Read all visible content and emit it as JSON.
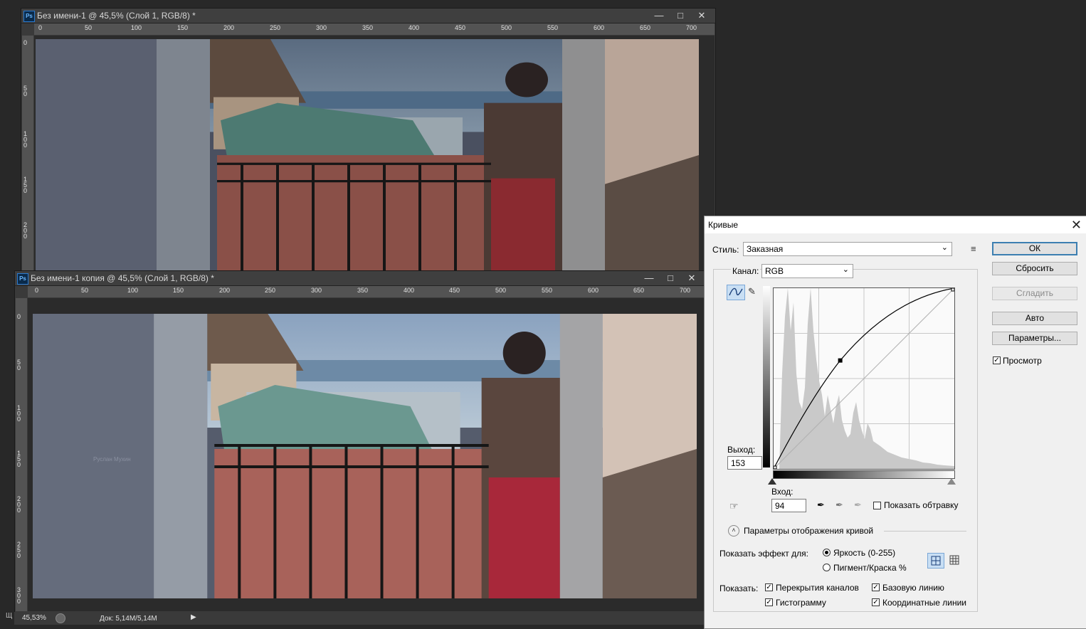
{
  "window1": {
    "title": "Без имени-1 @ 45,5% (Слой 1, RGB/8) *",
    "ruler_h": [
      "0",
      "50",
      "100",
      "150",
      "200",
      "250",
      "300",
      "350",
      "400",
      "450",
      "500",
      "550",
      "600",
      "650",
      "700"
    ],
    "ruler_v": [
      "0",
      "50",
      "100",
      "150",
      "200"
    ]
  },
  "window2": {
    "title": "Без имени-1 копия @ 45,5% (Слой 1, RGB/8) *",
    "ruler_h": [
      "0",
      "50",
      "100",
      "150",
      "200",
      "250",
      "300",
      "350",
      "400",
      "450",
      "500",
      "550",
      "600",
      "650",
      "700"
    ],
    "ruler_v": [
      "0",
      "50",
      "100",
      "150",
      "200",
      "250",
      "300"
    ]
  },
  "watermark": "Руслан Мухин",
  "status": {
    "zoom": "45,53%",
    "doc": "Док: 5,14M/5,14M",
    "left_char": "Щ"
  },
  "curves": {
    "title": "Кривые",
    "style_label": "Стиль:",
    "style_value": "Заказная",
    "channel_label": "Канал:",
    "channel_value": "RGB",
    "output_label": "Выход:",
    "output_value": "153",
    "input_label": "Вход:",
    "input_value": "94",
    "show_clipping": "Показать обтравку",
    "display_options": "Параметры отображения кривой",
    "show_effect_for": "Показать эффект для:",
    "radio_light": "Яркость (0-255)",
    "radio_pigment": "Пигмент/Краска %",
    "show_label": "Показать:",
    "cb_overlays": "Перекрытия каналов",
    "cb_baseline": "Базовую линию",
    "cb_histogram": "Гистограмму",
    "cb_gridlines": "Координатные линии",
    "buttons": {
      "ok": "ОК",
      "reset": "Сбросить",
      "smooth": "Сгладить",
      "auto": "Авто",
      "options": "Параметры..."
    },
    "preview": "Просмотр",
    "point": {
      "input": 94,
      "output": 153
    }
  }
}
